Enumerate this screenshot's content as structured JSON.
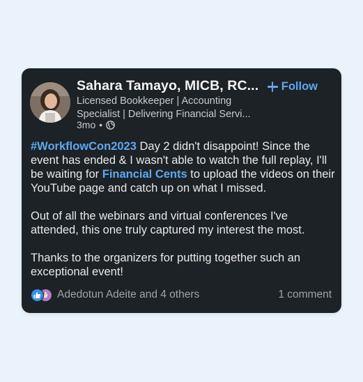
{
  "post": {
    "author": {
      "name": "Sahara Tamayo, MICB, RC...",
      "headline_line1": "Licensed Bookkeeper | Accounting",
      "headline_line2": "Specialist | Delivering Financial Servi...",
      "time": "3mo",
      "separator": "•",
      "visibility_icon": "globe-icon"
    },
    "follow_label": "Follow",
    "body": {
      "hashtag": "#WorkflowCon2023",
      "p1_part1": " Day 2 didn't disappoint! Since the event has ended & I wasn't able to watch the full replay, I'll be waiting for ",
      "mention": "Financial Cents",
      "p1_part2": "  to upload the videos on their YouTube page and catch up on what I missed.",
      "p2": "Out of all the webinars and virtual conferences I've attended, this one truly captured my interest the most.",
      "p3": "Thanks to the organizers for putting together such an exceptional event!"
    },
    "reactions": {
      "icons": [
        "like-icon",
        "celebrate-icon"
      ],
      "text": "Adedotun Adeite and 4 others"
    },
    "comments_label": "1 comment"
  },
  "colors": {
    "background": "#eaf2fc",
    "card": "#1d2226",
    "accent": "#5ea8ef",
    "text": "#e9e9e9",
    "muted": "#9fa3a6"
  }
}
